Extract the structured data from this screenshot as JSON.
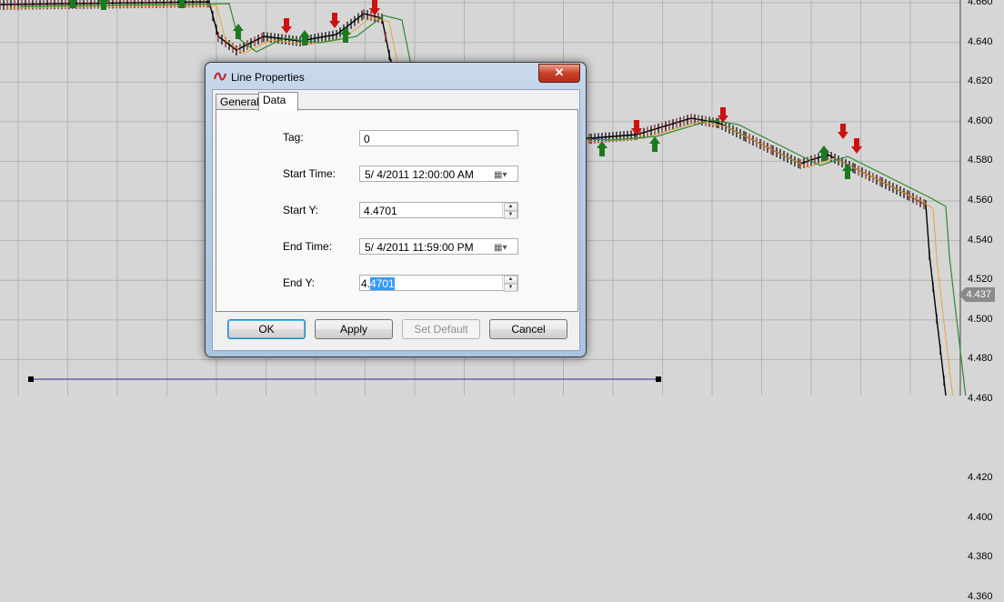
{
  "chart": {
    "y_ticks": [
      "4.660",
      "4.640",
      "4.620",
      "4.600",
      "4.580",
      "4.560",
      "4.540",
      "4.520",
      "4.500",
      "4.480",
      "4.460",
      "4.437",
      "4.420",
      "4.400",
      "4.380",
      "4.360"
    ],
    "current_price": "4.437",
    "colors": {
      "ema_fast": "#e7a33a",
      "ema_slow": "#2e8b2e",
      "line": "#2b2b9b",
      "up_arrow": "#1b7a1b",
      "down_arrow": "#cc1111"
    }
  },
  "dialog": {
    "title": "Line Properties",
    "close_symbol": "✕",
    "tabs": [
      {
        "label": "General"
      },
      {
        "label": "Data"
      }
    ],
    "fields": {
      "tag": {
        "label": "Tag:",
        "value": "0"
      },
      "start_time": {
        "label": "Start Time:",
        "value": "5/  4/2011 12:00:00 AM"
      },
      "start_y": {
        "label": "Start Y:",
        "value": "4.4701"
      },
      "end_time": {
        "label": "End Time:",
        "value": "5/  4/2011 11:59:00 PM"
      },
      "end_y": {
        "label": "End Y:",
        "value_prefix": "4.",
        "value_selected": "4701"
      }
    },
    "buttons": {
      "ok": "OK",
      "apply": "Apply",
      "set_default": "Set Default",
      "cancel": "Cancel"
    }
  }
}
